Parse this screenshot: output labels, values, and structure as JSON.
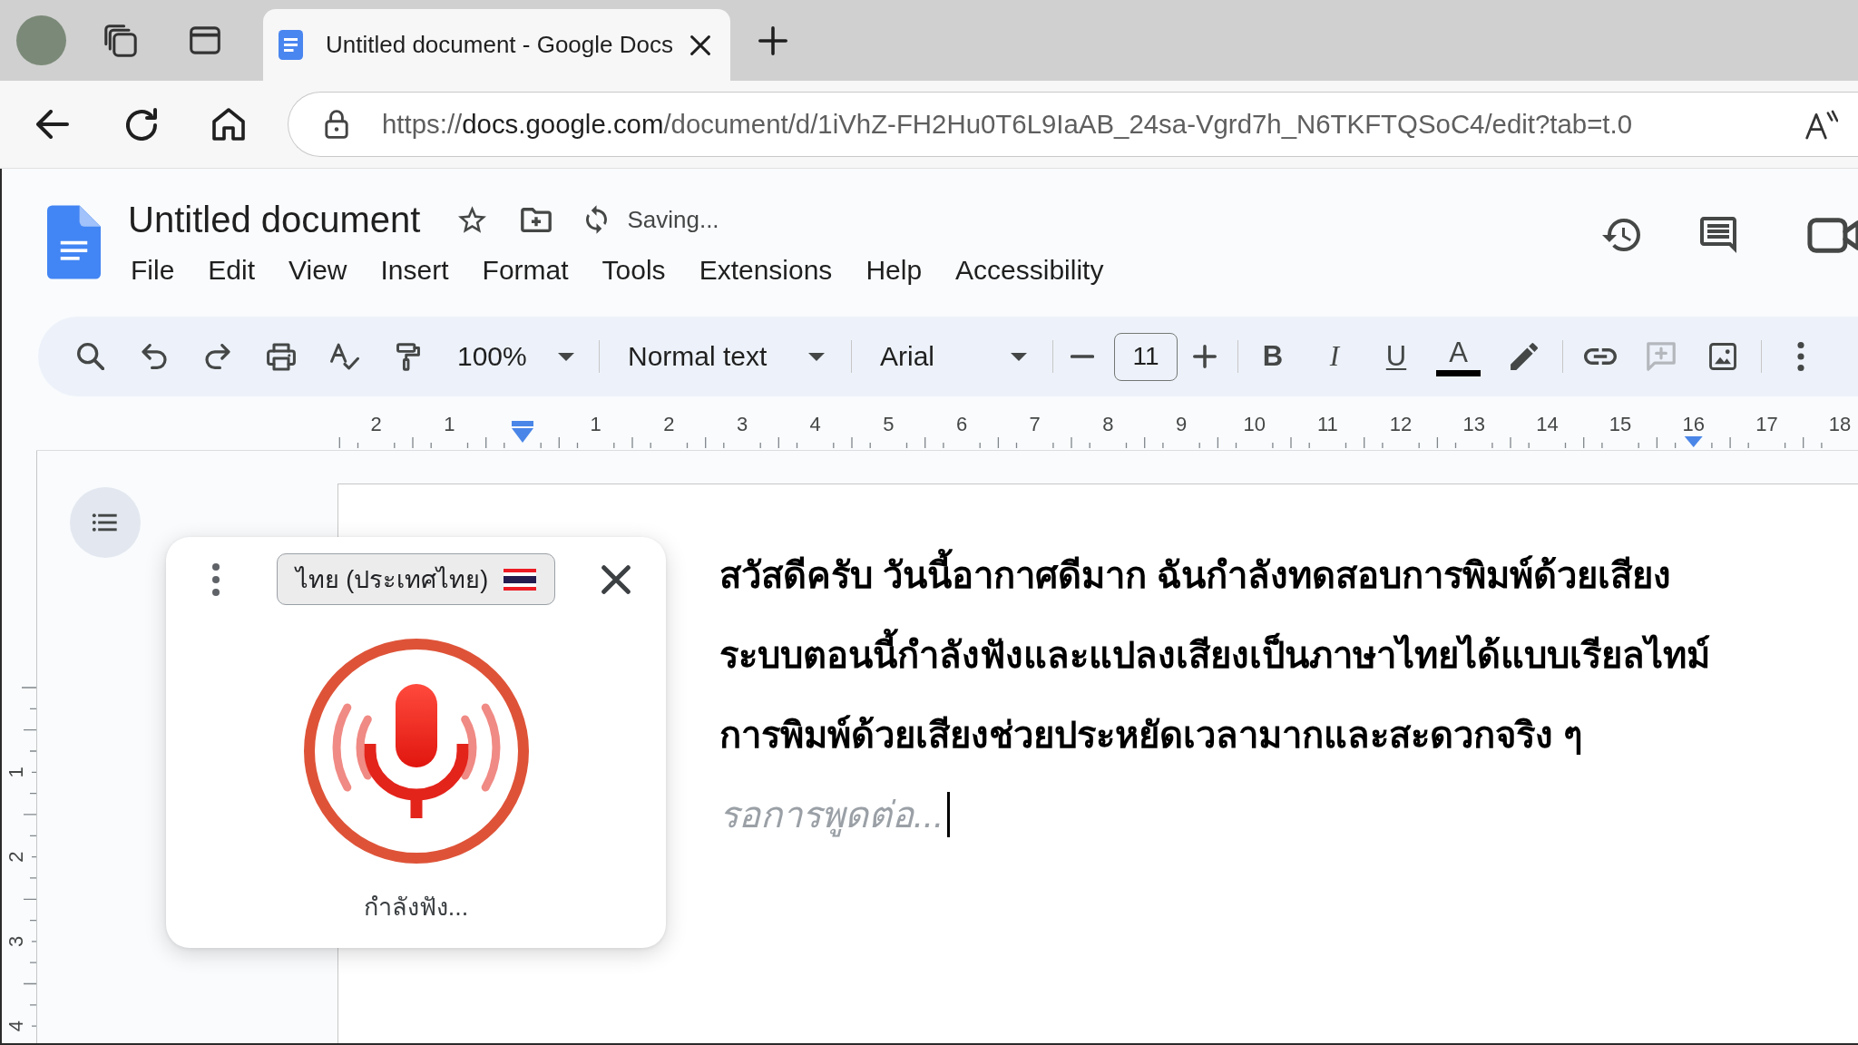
{
  "browser": {
    "tabs": [
      {
        "title": "Untitled document - Google Docs",
        "selected": true
      }
    ],
    "address_bar": {
      "scheme": "https://",
      "host": "docs.google.com",
      "path": "/document/d/1iVhZ-FH2Hu0T6L9IaAB_24sa-Vgrd7h_N6TKFTQSoC4/edit?tab=t.0"
    }
  },
  "header": {
    "title": "Untitled document",
    "save_status": "Saving...",
    "menu": [
      "File",
      "Edit",
      "View",
      "Insert",
      "Format",
      "Tools",
      "Extensions",
      "Help",
      "Accessibility"
    ]
  },
  "toolbar": {
    "zoom": "100%",
    "paragraph_style": "Normal text",
    "font": "Arial",
    "font_size": "11",
    "format_buttons": [
      {
        "kind": "bold",
        "label": "B"
      },
      {
        "kind": "italic",
        "label": "I"
      },
      {
        "kind": "underline",
        "label": "U"
      }
    ],
    "text_color": {
      "label": "A"
    },
    "add_comment": {
      "disabled": true
    }
  },
  "ruler": {
    "left_labels": [
      "2",
      "1"
    ],
    "labels": [
      "1",
      "2",
      "3",
      "4",
      "5",
      "6",
      "7",
      "8",
      "9",
      "10",
      "11",
      "12",
      "13",
      "14",
      "15",
      "16",
      "17",
      "18"
    ]
  },
  "vertical_ruler": {
    "labels": [
      "1",
      "2",
      "3",
      "4"
    ]
  },
  "voice_typing": {
    "language": "ไทย (ประเทศไทย)",
    "status": "กำลังฟัง..."
  },
  "document": {
    "paragraphs": [
      "สวัสดีครับ วันนี้อากาศดีมาก ฉันกำลังทดสอบการพิมพ์ด้วยเสียง",
      "ระบบตอนนี้กำลังฟังและแปลงเสียงเป็นภาษาไทยได้แบบเรียลไทม์",
      "การพิมพ์ด้วยเสียงช่วยประหยัดเวลามากและสะดวกจริง ๆ"
    ],
    "interim": "รอการพูดต่อ..."
  }
}
